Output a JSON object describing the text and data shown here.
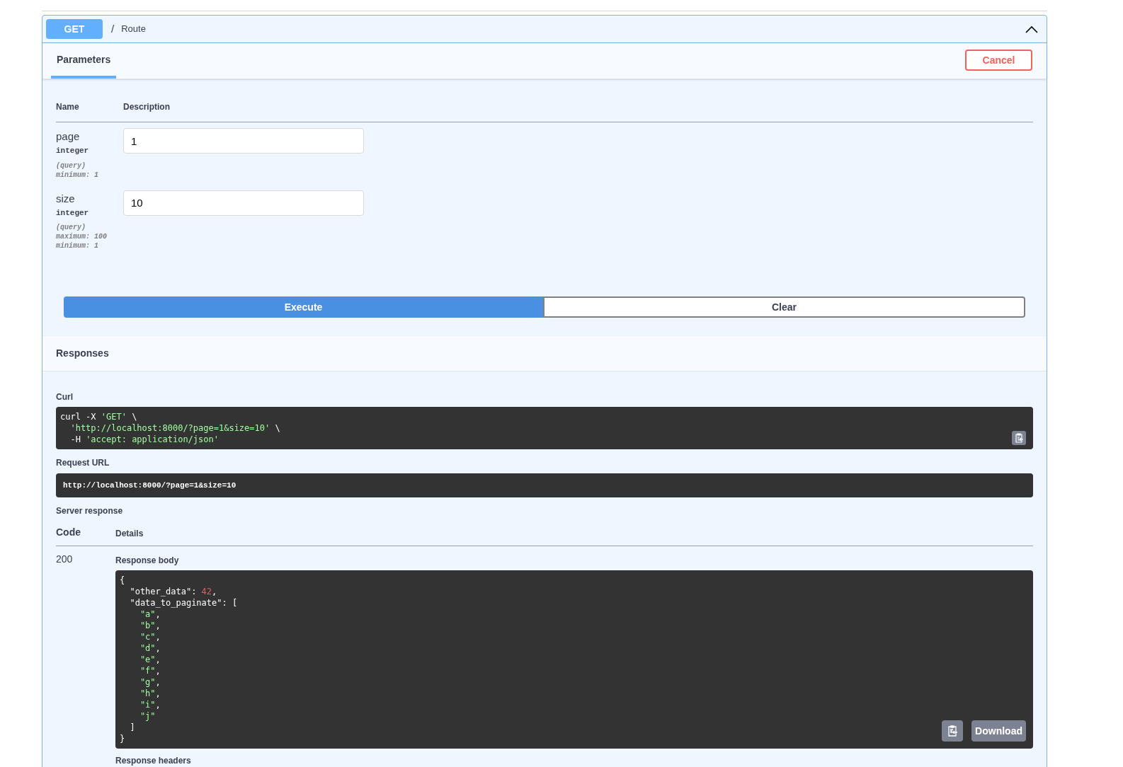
{
  "operation": {
    "method": "GET",
    "separator": "/",
    "path": "Route",
    "expanded": true
  },
  "tabs": [
    {
      "label": "Parameters",
      "selected": true
    }
  ],
  "cancel_button": "Cancel",
  "parameters": {
    "columns": [
      "Name",
      "Description"
    ],
    "rows": [
      {
        "name": "page",
        "type": "integer",
        "location": "(query)",
        "constraints": [
          "minimum: 1"
        ],
        "value": "1"
      },
      {
        "name": "size",
        "type": "integer",
        "location": "(query)",
        "constraints": [
          "maximum: 100",
          "minimum: 1"
        ],
        "value": "10"
      }
    ]
  },
  "buttons": [
    {
      "label": "Execute",
      "kind": "primary"
    },
    {
      "label": "Clear",
      "kind": "secondary"
    }
  ],
  "responses_title": "Responses",
  "curl": {
    "label": "Curl",
    "lines": [
      [
        {
          "text": "curl -X ",
          "kind": "plain"
        },
        {
          "text": "'GET'",
          "kind": "string"
        },
        {
          "text": " \\",
          "kind": "plain"
        }
      ],
      [
        {
          "text": "  'http://localhost:8000/?page=1&size=10'",
          "kind": "string"
        },
        {
          "text": " \\",
          "kind": "plain"
        }
      ],
      [
        {
          "text": "  -H ",
          "kind": "plain"
        },
        {
          "text": "'accept: application/json'",
          "kind": "string"
        }
      ]
    ]
  },
  "request_url": {
    "label": "Request URL",
    "value": "http://localhost:8000/?page=1&size=10"
  },
  "server_response": {
    "label": "Server response",
    "columns": [
      "Code",
      "Details"
    ],
    "code": "200",
    "body_label": "Response body",
    "body_lines": [
      [
        {
          "text": "{",
          "kind": "plain"
        }
      ],
      [
        {
          "text": "  \"other_data\": ",
          "kind": "plain"
        },
        {
          "text": "42",
          "kind": "number"
        },
        {
          "text": ",",
          "kind": "plain"
        }
      ],
      [
        {
          "text": "  \"data_to_paginate\": [",
          "kind": "plain"
        }
      ],
      [
        {
          "text": "    \"a\"",
          "kind": "string"
        },
        {
          "text": ",",
          "kind": "plain"
        }
      ],
      [
        {
          "text": "    \"b\"",
          "kind": "string"
        },
        {
          "text": ",",
          "kind": "plain"
        }
      ],
      [
        {
          "text": "    \"c\"",
          "kind": "string"
        },
        {
          "text": ",",
          "kind": "plain"
        }
      ],
      [
        {
          "text": "    \"d\"",
          "kind": "string"
        },
        {
          "text": ",",
          "kind": "plain"
        }
      ],
      [
        {
          "text": "    \"e\"",
          "kind": "string"
        },
        {
          "text": ",",
          "kind": "plain"
        }
      ],
      [
        {
          "text": "    \"f\"",
          "kind": "string"
        },
        {
          "text": ",",
          "kind": "plain"
        }
      ],
      [
        {
          "text": "    \"g\"",
          "kind": "string"
        },
        {
          "text": ",",
          "kind": "plain"
        }
      ],
      [
        {
          "text": "    \"h\"",
          "kind": "string"
        },
        {
          "text": ",",
          "kind": "plain"
        }
      ],
      [
        {
          "text": "    \"i\"",
          "kind": "string"
        },
        {
          "text": ",",
          "kind": "plain"
        }
      ],
      [
        {
          "text": "    \"j\"",
          "kind": "string"
        }
      ],
      [
        {
          "text": "  ]",
          "kind": "plain"
        }
      ],
      [
        {
          "text": "}",
          "kind": "plain"
        }
      ]
    ],
    "download_button": "Download",
    "headers_label": "Response headers"
  }
}
